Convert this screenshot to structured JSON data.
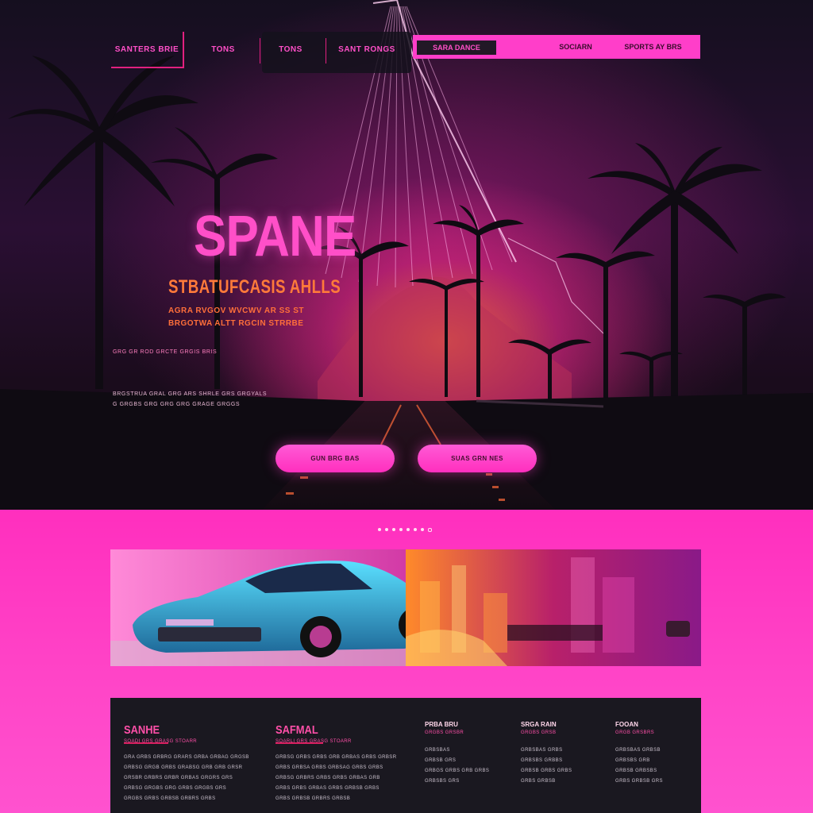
{
  "nav": {
    "brand": "SANTERS BRIE",
    "items": [
      "TONS",
      "TONS",
      "SANT RONGS"
    ],
    "pink_tab": "SARA DANCE",
    "pink_items": [
      "SOCIARN",
      "SPORTS AY BRS"
    ]
  },
  "hero": {
    "title": "SPANE",
    "subtitle": "STBATUFCASIS AHLLS",
    "lines": [
      "AGRA RVGOV WVCWV AR SS ST",
      "BRGOTWA ALTT RGCIN STRRBE"
    ],
    "small_line": "GRG GR ROD GRCTE GRGIS BRIS",
    "paragraph": [
      "BRGSTRUA GRAL GRG ARS SHRLE GRS GRGYALS",
      "G GRGBS GRG GRG GRG GRAGE GRGGS"
    ],
    "buttons": [
      "GUN BRG BAS",
      "SUAS GRN NES"
    ]
  },
  "carousel": {
    "dots": 8,
    "active": 7
  },
  "footer": {
    "columns": [
      {
        "title": "SANHE",
        "caption": "SOADI GRS GRASG STOARR",
        "lines": [
          "GRA GRBS GRBRG GRARS GRBA GRBAG GRGSB",
          "GRBSG GRGB GRBS GRABSG GRB GRB GRSR",
          "GRSBR GRBRS GRBR GRBAS GRGRS GRS",
          "GRBSG GRGBS GRG GRBS GRGBS GRS",
          "GRGBS GRBS GRBSB GRBRS GRBS"
        ]
      },
      {
        "title": "SAFMAL",
        "caption": "SOARLI GRS GRASG STOARR",
        "lines": [
          "GRBSG GRBS GRBS GRB GRBAS GRBS GRBSR",
          "GRBS GRBSA GRBS GRBSAG GRBS GRBS",
          "GRBSG GRBRS GRBS GRBS GRBAS GRB",
          "GRBS GRBS GRBAS GRBS GRBSB GRBS",
          "GRBS GRBSB GRBRS GRBSB"
        ]
      },
      {
        "title": "PRBA BRU",
        "caption": "GRGBS GRSBR",
        "lines": [
          "GRBSBAS",
          "GRBSB GRS",
          "GRBGS GRBS GRB GRBS",
          "GRBSBS GRS"
        ]
      },
      {
        "title": "SRGA RAIN",
        "caption": "GRGBS GRSB",
        "lines": [
          "GRBSBAS GRBS",
          "GRBSBS GRBBS",
          "GRBSB GRBS GRBS",
          "GRBS GRBSB"
        ]
      },
      {
        "title": "FOOAN",
        "caption": "GRGB GRSBRS",
        "lines": [
          "GRBSBAS GRBSB",
          "GRBSBS GRB",
          "GRBSB GRBSBS",
          "GRBS GRBSB GRS"
        ]
      }
    ]
  },
  "colors": {
    "accent_pink": "#ff3ec9",
    "accent_orange": "#ff7a3a",
    "dark": "#1a1820"
  }
}
